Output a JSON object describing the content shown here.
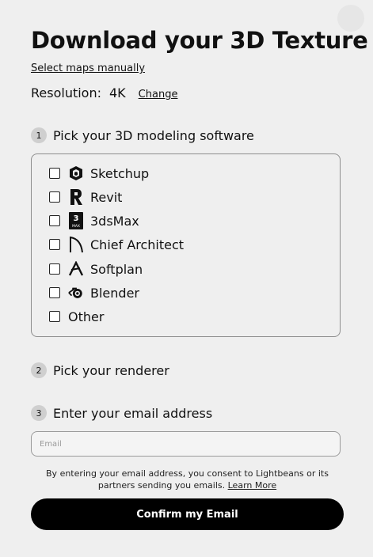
{
  "header": {
    "title": "Download your 3D Texture",
    "select_maps_link": "Select maps manually"
  },
  "resolution": {
    "label": "Resolution:",
    "value": "4K",
    "change_link": "Change"
  },
  "steps": [
    {
      "number": "1",
      "label": "Pick your 3D modeling software"
    },
    {
      "number": "2",
      "label": "Pick your renderer"
    },
    {
      "number": "3",
      "label": "Enter your email address"
    }
  ],
  "software_options": [
    {
      "label": "Sketchup",
      "icon": "sketchup-icon",
      "checked": false
    },
    {
      "label": "Revit",
      "icon": "revit-icon",
      "checked": false
    },
    {
      "label": "3dsMax",
      "icon": "3dsmax-icon",
      "icon_text": "3",
      "icon_subtext": "MAX",
      "checked": false
    },
    {
      "label": "Chief Architect",
      "icon": "chief-architect-icon",
      "checked": false
    },
    {
      "label": "Softplan",
      "icon": "softplan-icon",
      "checked": false
    },
    {
      "label": "Blender",
      "icon": "blender-icon",
      "checked": false
    },
    {
      "label": "Other",
      "icon": null,
      "checked": false
    }
  ],
  "email": {
    "placeholder": "Email",
    "value": ""
  },
  "consent": {
    "text": "By entering your email address, you consent to Lightbeans or its partners sending you emails.",
    "learn_more": "Learn More"
  },
  "confirm_button": "Confirm my Email",
  "colors": {
    "background": "#efefef",
    "button": "#000000",
    "button_text": "#ffffff",
    "step_badge": "#cfcfcf"
  }
}
